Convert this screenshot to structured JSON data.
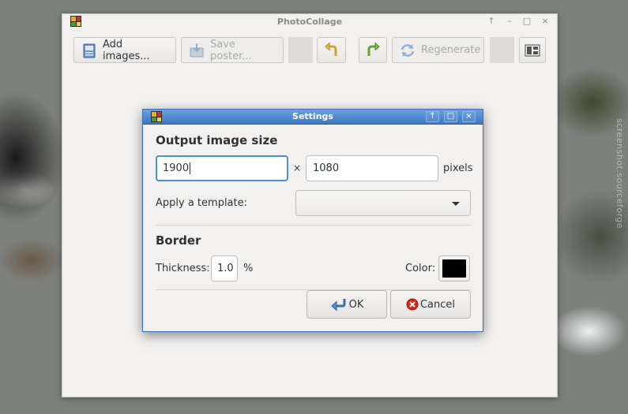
{
  "main_window": {
    "title": "PhotoCollage",
    "controls": [
      "↑",
      "–",
      "□",
      "×"
    ]
  },
  "toolbar": {
    "add_images": "Add images...",
    "save_poster": "Save poster...",
    "regenerate": "Regenerate",
    "icons": [
      "add-images-icon",
      "save-poster-icon",
      "undo-icon",
      "redo-icon",
      "regenerate-icon",
      "settings-icon"
    ]
  },
  "dialog": {
    "title": "Settings",
    "controls": [
      "↑",
      "□",
      "×"
    ],
    "output_heading": "Output image size",
    "width_value": "1900",
    "times": "×",
    "height_value": "1080",
    "pixels_label": "pixels",
    "template_label": "Apply a template:",
    "template_value": "",
    "border_heading": "Border",
    "thickness_label": "Thickness:",
    "thickness_value": "1.0",
    "percent_label": "%",
    "color_label": "Color:",
    "border_color": "#000000",
    "ok_label": "OK",
    "cancel_label": "Cancel"
  },
  "desktop": {
    "watermark": "screenshot.sourceforge"
  },
  "colors": {
    "accent": "#4a90d9",
    "dialog_title_bg": "#3c77c2",
    "window_bg": "#f2f1f0"
  }
}
